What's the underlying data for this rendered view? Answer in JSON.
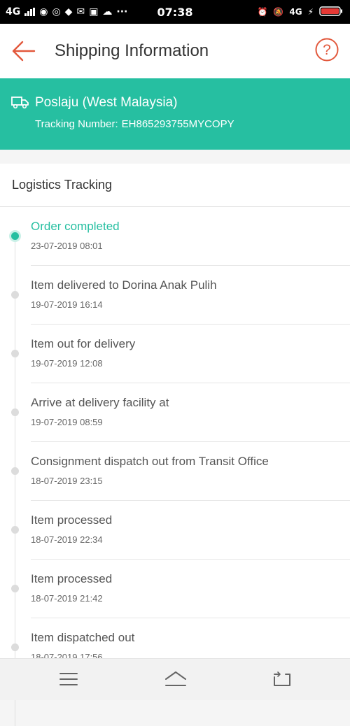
{
  "status_bar": {
    "network": "4G",
    "time": "07:38",
    "network_right": "4G",
    "dots": "···"
  },
  "header": {
    "title": "Shipping Information"
  },
  "carrier": {
    "name": "Poslaju (West Malaysia)",
    "tracking_label": "Tracking Number:",
    "tracking_number": "EH865293755MYCOPY"
  },
  "logistics": {
    "title": "Logistics Tracking",
    "events": [
      {
        "description": "Order completed",
        "time": "23-07-2019 08:01",
        "active": true
      },
      {
        "description": "Item delivered to Dorina Anak Pulih",
        "time": "19-07-2019 16:14"
      },
      {
        "description": "Item out for delivery",
        "time": "19-07-2019 12:08"
      },
      {
        "description": "Arrive at delivery facility at",
        "time": "19-07-2019 08:59"
      },
      {
        "description": "Consignment dispatch out from Transit Office",
        "time": "18-07-2019 23:15"
      },
      {
        "description": "Item processed",
        "time": "18-07-2019 22:34"
      },
      {
        "description": "Item processed",
        "time": "18-07-2019 21:42"
      },
      {
        "description": "Item dispatched out",
        "time": "18-07-2019 17:56"
      }
    ]
  },
  "colors": {
    "accent": "#26bfa1",
    "header_icon": "#e2583c"
  },
  "icons": {
    "back": "arrow-left-icon",
    "help": "question-circle-icon",
    "carrier": "truck-icon",
    "nav_menu": "menu-icon",
    "nav_home": "home-icon",
    "nav_back": "back-icon"
  }
}
